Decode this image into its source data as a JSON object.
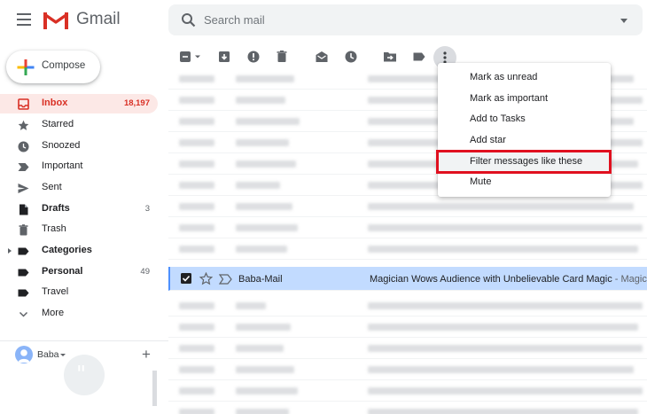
{
  "app": {
    "brand": "Gmail",
    "accent_color": "#d93025",
    "selected_row_color": "#c2dbff"
  },
  "search": {
    "placeholder": "Search mail"
  },
  "compose": {
    "label": "Compose"
  },
  "sidebar": {
    "items": [
      {
        "label": "Inbox",
        "count": "18,197",
        "icon": "inbox-icon",
        "active": true
      },
      {
        "label": "Starred",
        "count": "",
        "icon": "star-icon"
      },
      {
        "label": "Snoozed",
        "count": "",
        "icon": "clock-icon"
      },
      {
        "label": "Important",
        "count": "",
        "icon": "important-icon"
      },
      {
        "label": "Sent",
        "count": "",
        "icon": "send-icon"
      },
      {
        "label": "Drafts",
        "count": "3",
        "icon": "draft-icon",
        "bold": true
      },
      {
        "label": "Trash",
        "count": "",
        "icon": "trash-icon"
      },
      {
        "label": "Categories",
        "count": "",
        "icon": "label-icon",
        "bold": true
      },
      {
        "label": "Personal",
        "count": "49",
        "icon": "label-icon",
        "bold": true
      },
      {
        "label": "Travel",
        "count": "",
        "icon": "label-icon"
      },
      {
        "label": "More",
        "count": "",
        "icon": "chevron-down-icon"
      }
    ],
    "user": {
      "name": "Baba"
    }
  },
  "toolbar": {
    "icons": [
      "select-all-checkbox",
      "archive-icon",
      "report-spam-icon",
      "delete-icon",
      "mark-read-icon",
      "snooze-icon",
      "move-to-icon",
      "label-icon",
      "more-icon"
    ]
  },
  "selected_email": {
    "sender": "Baba-Mail",
    "subject": "Magician Wows Audience with Unbelievable Card Magic",
    "snippet": " - Magician"
  },
  "menu": {
    "items": [
      {
        "label": "Mark as unread"
      },
      {
        "label": "Mark as important"
      },
      {
        "label": "Add to Tasks"
      },
      {
        "label": "Add star"
      },
      {
        "label": "Filter messages like these",
        "highlighted": true
      },
      {
        "label": "Mute"
      }
    ]
  }
}
